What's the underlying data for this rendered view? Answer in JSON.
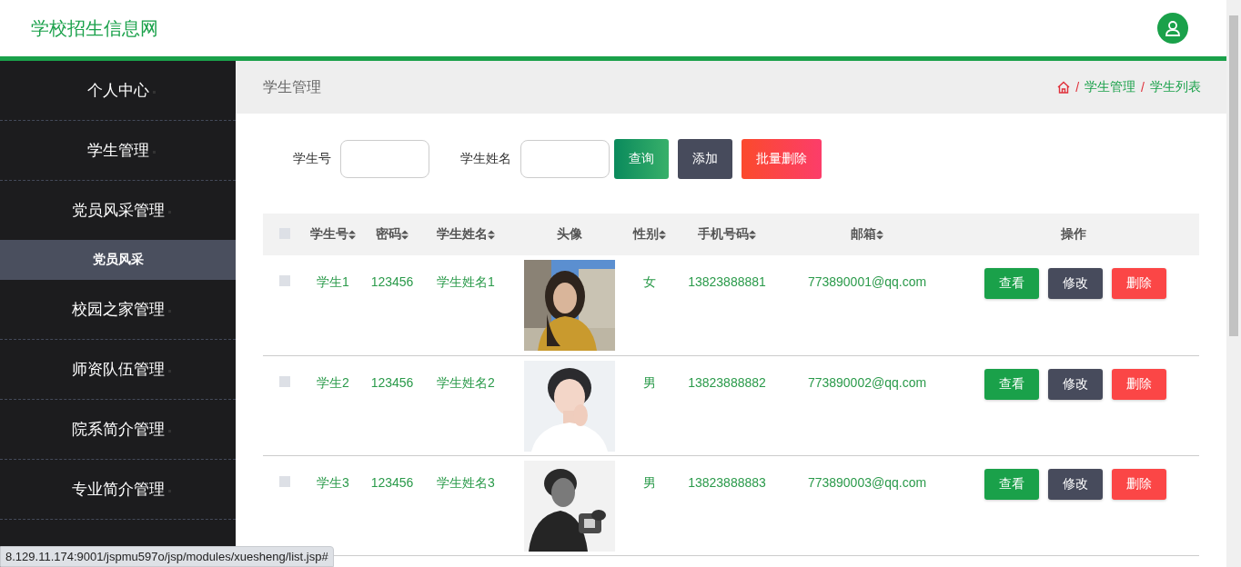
{
  "header": {
    "title": "学校招生信息网"
  },
  "sidebar": {
    "items": [
      {
        "label": "个人中心",
        "expanded": false
      },
      {
        "label": "学生管理",
        "expanded": false
      },
      {
        "label": "党员风采管理",
        "expanded": true,
        "children": [
          {
            "label": "党员风采",
            "selected": true
          }
        ]
      },
      {
        "label": "校园之家管理",
        "expanded": false
      },
      {
        "label": "师资队伍管理",
        "expanded": false
      },
      {
        "label": "院系简介管理",
        "expanded": false
      },
      {
        "label": "专业简介管理",
        "expanded": false
      }
    ]
  },
  "page_title": "学生管理",
  "breadcrumb": {
    "separator": "/",
    "items": [
      "学生管理",
      "学生列表"
    ]
  },
  "search": {
    "fields": [
      {
        "label": "学生号"
      },
      {
        "label": "学生姓名"
      }
    ],
    "buttons": [
      {
        "label": "查询",
        "kind": "query"
      },
      {
        "label": "添加",
        "kind": "add"
      },
      {
        "label": "批量删除",
        "kind": "danger"
      }
    ]
  },
  "table": {
    "all_checked": false,
    "columns": [
      {
        "label": "学生号",
        "sortable": true
      },
      {
        "label": "密码",
        "sortable": true
      },
      {
        "label": "学生姓名",
        "sortable": true
      },
      {
        "label": "头像",
        "sortable": false
      },
      {
        "label": "性别",
        "sortable": true
      },
      {
        "label": "手机号码",
        "sortable": true
      },
      {
        "label": "邮箱",
        "sortable": true
      },
      {
        "label": "操作",
        "sortable": false
      }
    ],
    "rows": [
      {
        "checked": false,
        "cells": [
          "学生1",
          "123456",
          "学生姓名1"
        ],
        "gender": "女",
        "phone": "13823888881",
        "email": "773890001@qq.com",
        "actions": [
          {
            "label": "查看",
            "kind": "view"
          },
          {
            "label": "修改",
            "kind": "edit"
          },
          {
            "label": "删除",
            "kind": "delete"
          }
        ]
      },
      {
        "checked": false,
        "cells": [
          "学生2",
          "123456",
          "学生姓名2"
        ],
        "gender": "男",
        "phone": "13823888882",
        "email": "773890002@qq.com",
        "actions": [
          {
            "label": "查看",
            "kind": "view"
          },
          {
            "label": "修改",
            "kind": "edit"
          },
          {
            "label": "删除",
            "kind": "delete"
          }
        ]
      },
      {
        "checked": false,
        "cells": [
          "学生3",
          "123456",
          "学生姓名3"
        ],
        "gender": "男",
        "phone": "13823888883",
        "email": "773890003@qq.com",
        "actions": [
          {
            "label": "查看",
            "kind": "view"
          },
          {
            "label": "修改",
            "kind": "edit"
          },
          {
            "label": "删除",
            "kind": "delete"
          }
        ]
      }
    ]
  },
  "status_bar": {
    "url": "8.129.11.174:9001/jspmu597o/jsp/modules/xuesheng/list.jsp#"
  }
}
